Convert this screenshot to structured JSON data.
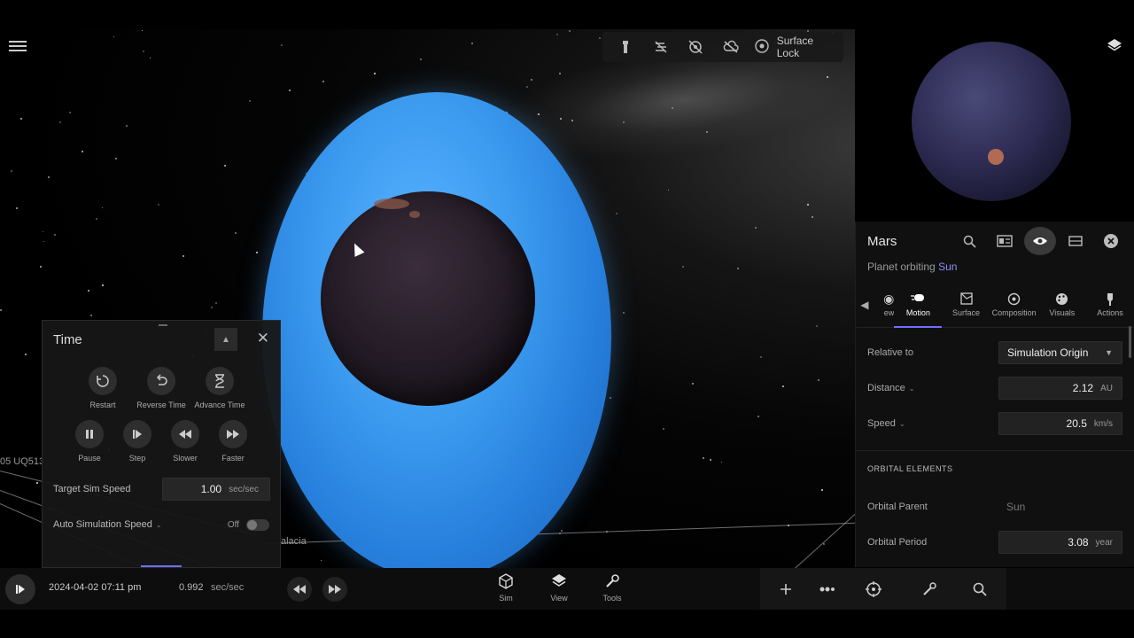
{
  "scene": {
    "labels": [
      "05 UQ513",
      "alacia"
    ]
  },
  "top_toolbar": {
    "icons": [
      "flashlight-icon",
      "no-lines-icon",
      "no-orbits-icon",
      "no-clouds-icon"
    ],
    "surface_lock_label": "Surface Lock"
  },
  "object_panel": {
    "name": "Mars",
    "subtitle_prefix": "Planet orbiting",
    "subtitle_link": "Sun",
    "tabs": [
      {
        "label": "ew",
        "icon": "view-icon"
      },
      {
        "label": "Motion",
        "icon": "motion-icon",
        "active": true
      },
      {
        "label": "Surface",
        "icon": "surface-icon"
      },
      {
        "label": "Composition",
        "icon": "composition-icon"
      },
      {
        "label": "Visuals",
        "icon": "palette-icon"
      },
      {
        "label": "Actions",
        "icon": "actions-icon"
      }
    ],
    "relative_to": {
      "label": "Relative to",
      "value": "Simulation Origin"
    },
    "distance": {
      "label": "Distance",
      "value": "2.12",
      "unit": "AU"
    },
    "speed": {
      "label": "Speed",
      "value": "20.5",
      "unit": "km/s"
    },
    "orbital_elements_heading": "ORBITAL ELEMENTS",
    "orbital_parent": {
      "label": "Orbital Parent",
      "value": "Sun"
    },
    "orbital_period": {
      "label": "Orbital Period",
      "value": "3.08",
      "unit": "year"
    }
  },
  "time_panel": {
    "title": "Time",
    "buttons_row1": [
      {
        "label": "Restart",
        "icon": "restart-icon"
      },
      {
        "label": "Reverse Time",
        "icon": "reverse-time-icon"
      },
      {
        "label": "Advance Time",
        "icon": "hourglass-icon"
      }
    ],
    "buttons_row2": [
      {
        "label": "Pause",
        "icon": "pause-icon"
      },
      {
        "label": "Step",
        "icon": "step-icon"
      },
      {
        "label": "Slower",
        "icon": "slower-icon"
      },
      {
        "label": "Faster",
        "icon": "faster-icon"
      }
    ],
    "target_sim_speed": {
      "label": "Target Sim Speed",
      "value": "1.00",
      "unit": "sec/sec"
    },
    "auto_sim_speed": {
      "label": "Auto Simulation Speed",
      "state": "Off"
    }
  },
  "bottom_bar": {
    "datetime": "2024-04-02 07:11 pm",
    "speed_value": "0.992",
    "speed_unit": "sec/sec",
    "tools": [
      {
        "label": "Sim",
        "icon": "cube-icon"
      },
      {
        "label": "View",
        "icon": "layers-icon"
      },
      {
        "label": "Tools",
        "icon": "wrench-icon"
      }
    ]
  }
}
